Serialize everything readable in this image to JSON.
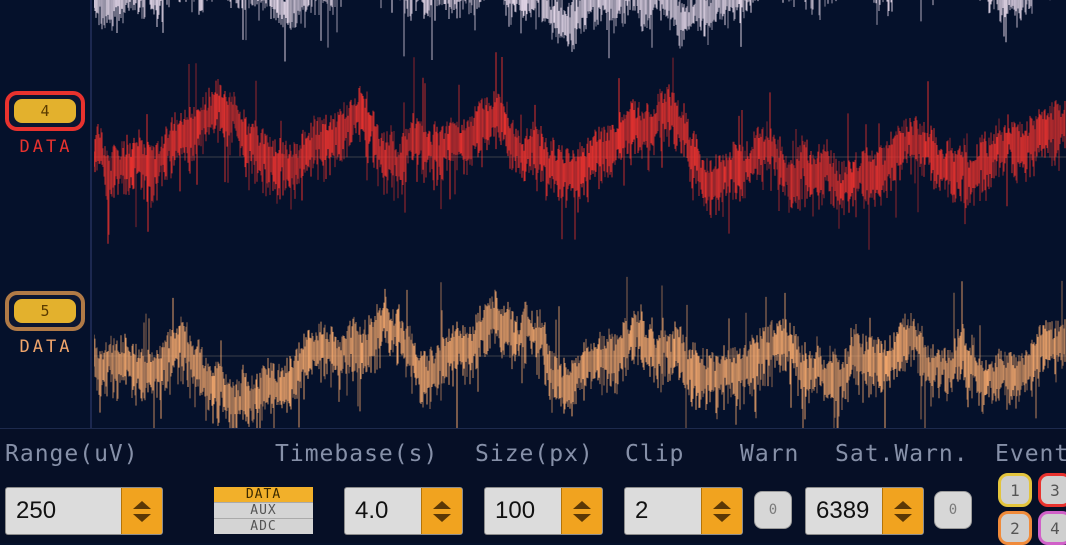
{
  "channels": [
    {
      "number": "4",
      "label": "DATA",
      "color": "#e8322e",
      "button_border": "#e8322e"
    },
    {
      "number": "5",
      "label": "DATA",
      "color": "#f0a56b",
      "button_border": "#b07a46"
    }
  ],
  "top_partial_trace_color": "#e6d9ea",
  "controls": {
    "range": {
      "label": "Range(uV)",
      "value": "250"
    },
    "source": {
      "options": [
        "DATA",
        "AUX",
        "ADC"
      ],
      "selected": "DATA"
    },
    "timebase": {
      "label": "Timebase(s)",
      "value": "4.0"
    },
    "size": {
      "label": "Size(px)",
      "value": "100"
    },
    "clip": {
      "label": "Clip",
      "value": "2"
    },
    "warn": {
      "label": "Warn",
      "button": "0"
    },
    "sat_warn": {
      "label": "Sat.Warn.",
      "value": "6389",
      "button": "0"
    },
    "events": {
      "label": "Event",
      "buttons": [
        "1",
        "3",
        "2",
        "4"
      ],
      "colors": [
        "#e3c43c",
        "#e8322e",
        "#f08a3a",
        "#d060c8"
      ]
    }
  },
  "accent_orange": "#f1a31f",
  "background": "#05112b"
}
